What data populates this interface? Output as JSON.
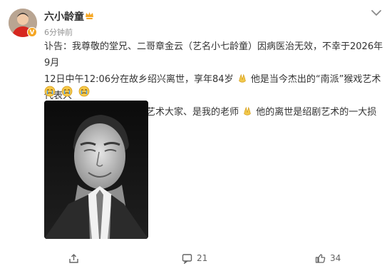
{
  "author": {
    "name": "六小龄童",
    "avatar": "avatar",
    "badge_icon": "verified-badge-icon",
    "vip_icon": "crown-icon"
  },
  "post": {
    "time": "6分钟前",
    "text_line_1": "讣告：我尊敬的堂兄、二哥章金云（艺名小七龄童）因病医治无效，不幸于2026年9月",
    "text_line_2a": "12日中午12:06分在故乡绍兴离世，享年84岁",
    "text_line_2b": "他是当今杰出的“南派”猴戏艺术代表人",
    "text_line_3a": "物之一、著名的绍剧表演艺术大家、是我的老师",
    "text_line_3b": "他的离世是绍剧艺术的一大损失．．",
    "pray_emoji": "pray-emoji",
    "cry_emojis": [
      "cry-emoji",
      "cry-emoji",
      "cry-emoji"
    ],
    "photo": "black-and-white portrait"
  },
  "actions": {
    "share_count": "",
    "comment_count": "21",
    "like_count": "34"
  },
  "colors": {
    "text": "#333333",
    "meta": "#939393",
    "action": "#636363",
    "badge": "#f5a623"
  }
}
